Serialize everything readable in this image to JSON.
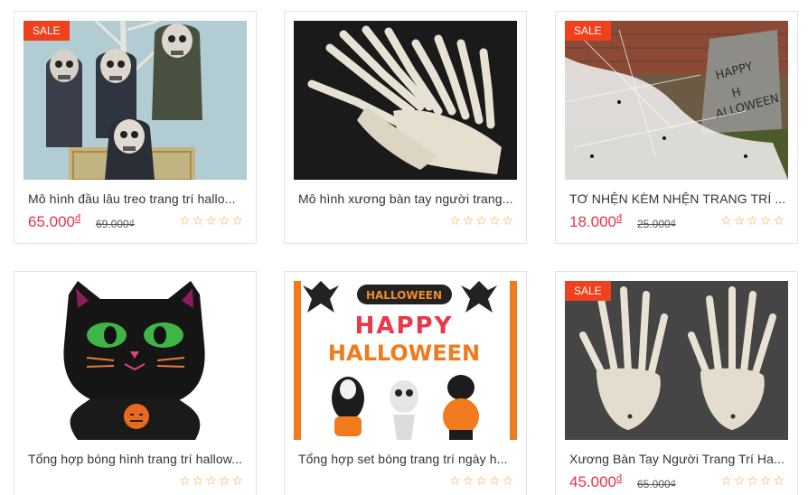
{
  "products": [
    {
      "title": "Mô hình đầu lâu treo trang trí hallo...",
      "image": "hanging-skull-decorations",
      "sale_badge": "SALE",
      "price": "65.000",
      "price_currency": "đ",
      "old_price": "69.000₫",
      "rating_stars": 0
    },
    {
      "title": "Mô hình xương bàn tay người trang...",
      "image": "skeleton-hands-prop",
      "sale_badge": "",
      "price": "",
      "price_currency": "",
      "old_price": "",
      "rating_stars": 0
    },
    {
      "title": "TƠ NHỆN KÈM NHỆN TRANG TRÍ ...",
      "image": "spider-web-decoration",
      "sale_badge": "SALE",
      "price": "18.000",
      "price_currency": "đ",
      "old_price": "25.000₫",
      "rating_stars": 0
    },
    {
      "title": "Tổng hợp bóng hình trang trí hallow...",
      "image": "black-cat-balloon",
      "sale_badge": "",
      "price": "",
      "price_currency": "",
      "old_price": "",
      "rating_stars": 0
    },
    {
      "title": "Tổng hợp set bóng trang trí ngày h...",
      "image": "happy-halloween-balloon-set",
      "image_text": [
        "HALLOWEEN",
        "HAPPY",
        "HALLOWEEN"
      ],
      "sale_badge": "",
      "price": "",
      "price_currency": "",
      "old_price": "",
      "rating_stars": 0
    },
    {
      "title": "Xương Bàn Tay Người Trang Trí Ha...",
      "image": "skeleton-hands-pair",
      "sale_badge": "SALE",
      "price": "45.000",
      "price_currency": "đ",
      "old_price": "65.000₫",
      "rating_stars": 0
    }
  ],
  "tombstone_text": [
    "HAPPY",
    "H",
    "ALLOWEEN"
  ],
  "colors": {
    "sale_badge": "#f0411f",
    "price": "#e8334e",
    "star": "#f39c3c",
    "border": "#e3e3e3"
  },
  "star_glyph": "☆"
}
